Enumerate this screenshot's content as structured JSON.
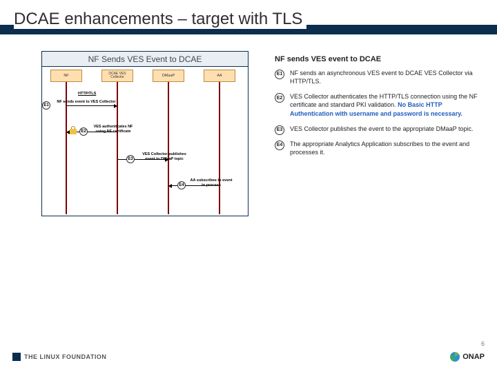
{
  "title": "DCAE enhancements – target with TLS",
  "diagram": {
    "header": "NF Sends VES Event to DCAE",
    "lanes": {
      "nf": "NF",
      "collector": "DCAE VES Collector",
      "dmaap": "DMaaP",
      "aa": "AA"
    },
    "tls_label": "HTTP/TLS",
    "steps": {
      "s1": {
        "num": "E1",
        "label": "NF sends event to VES Collector"
      },
      "s2": {
        "num": "E2",
        "label": "VES authenticates NF using NF certificate"
      },
      "s3": {
        "num": "E3",
        "label": "VES Collector publishes event to DMaaP topic"
      },
      "s4": {
        "num": "E4",
        "label": "AA subscribes to event to process"
      }
    }
  },
  "right": {
    "title": "NF sends VES event to DCAE",
    "items": [
      {
        "num": "E1",
        "text": "NF sends an asynchronous VES event to DCAE VES Collector via HTTP/TLS."
      },
      {
        "num": "E2",
        "text_pre": "VES Collector authenticates the HTTP/TLS connection using the NF certificate and standard PKI validation. ",
        "em": "No Basic HTTP Authentication with username and password is necessary."
      },
      {
        "num": "E3",
        "text": "VES Collector publishes the event to the appropriate DMaaP topic."
      },
      {
        "num": "E4",
        "text": "The appropriate Analytics Application subscribes to the event and processes it."
      }
    ]
  },
  "footer": {
    "lf": "THE LINUX FOUNDATION",
    "onap": "ONAP",
    "page": "6"
  }
}
